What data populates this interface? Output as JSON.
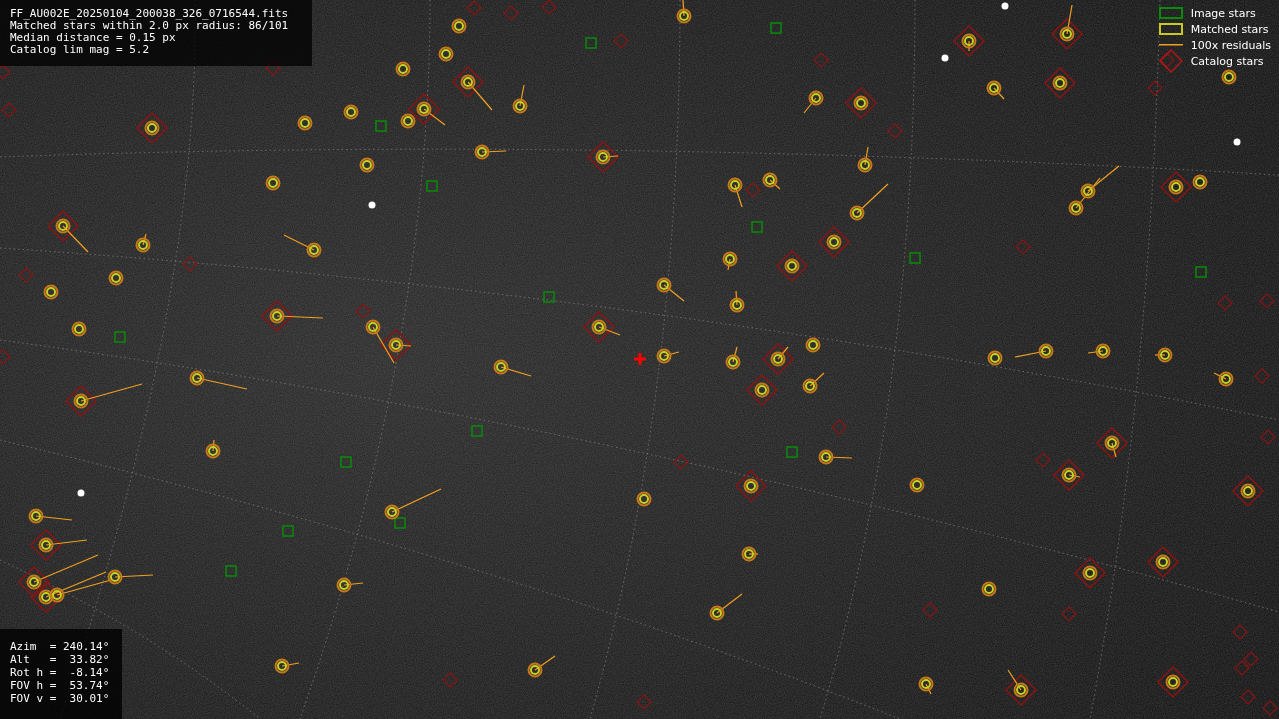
{
  "info": [
    "FF_AU002E_20250104_200038_326_0716544.fits",
    "Matched stars within 2.0 px radius: 86/101",
    "Median distance = 0.15 px",
    "Catalog lim mag = 5.2"
  ],
  "legend": [
    {
      "kind": "image",
      "label": "Image stars"
    },
    {
      "kind": "matched",
      "label": "Matched stars"
    },
    {
      "kind": "residual",
      "label": "100x residuals"
    },
    {
      "kind": "catalog",
      "label": "Catalog stars"
    }
  ],
  "pointing": [
    "Azim  = 240.14°",
    "Alt   =  33.82°",
    "Rot h =  -8.14°",
    "FOV h =  53.74°",
    "FOV v =  30.01°"
  ]
}
